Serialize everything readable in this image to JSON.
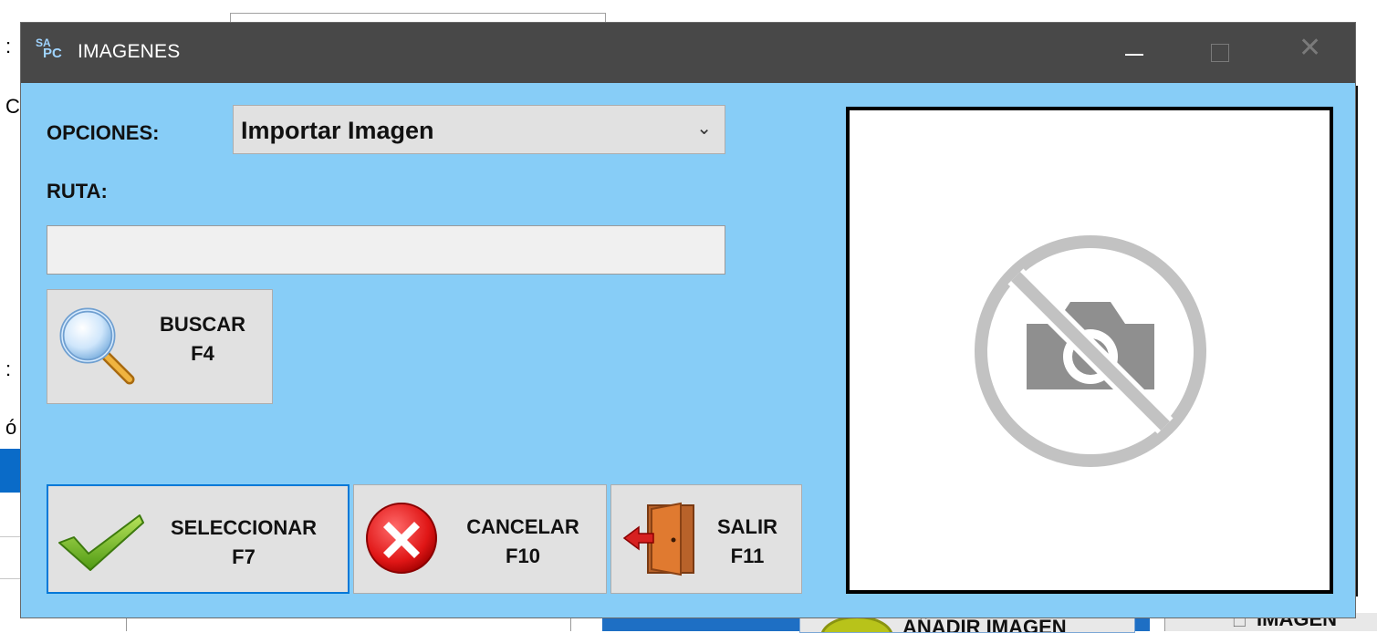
{
  "background": {
    "add_button_label": "AÑADIR IMAGEN",
    "image_button_label": "IMAGEN"
  },
  "window": {
    "title": "IMAGENES",
    "app_logo_text": "SAPC",
    "controls": [
      "minimize",
      "maximize",
      "close"
    ]
  },
  "form": {
    "opciones_label": "OPCIONES:",
    "opciones_selected": "Importar Imagen",
    "ruta_label": "RUTA:",
    "ruta_value": ""
  },
  "buttons": {
    "buscar": {
      "label": "BUSCAR",
      "key": "F4",
      "icon": "magnifier-icon"
    },
    "seleccionar": {
      "label": "SELECCIONAR",
      "key": "F7",
      "icon": "checkmark-icon"
    },
    "cancelar": {
      "label": "CANCELAR",
      "key": "F10",
      "icon": "cancel-x-icon"
    },
    "salir": {
      "label": "SALIR",
      "key": "F11",
      "icon": "exit-door-icon"
    }
  },
  "preview": {
    "icon": "no-camera-icon"
  },
  "colors": {
    "dialog_bg": "#87cdf7",
    "titlebar_bg": "#484848",
    "focus_border": "#0078d7",
    "button_bg": "#e1e1e1"
  }
}
